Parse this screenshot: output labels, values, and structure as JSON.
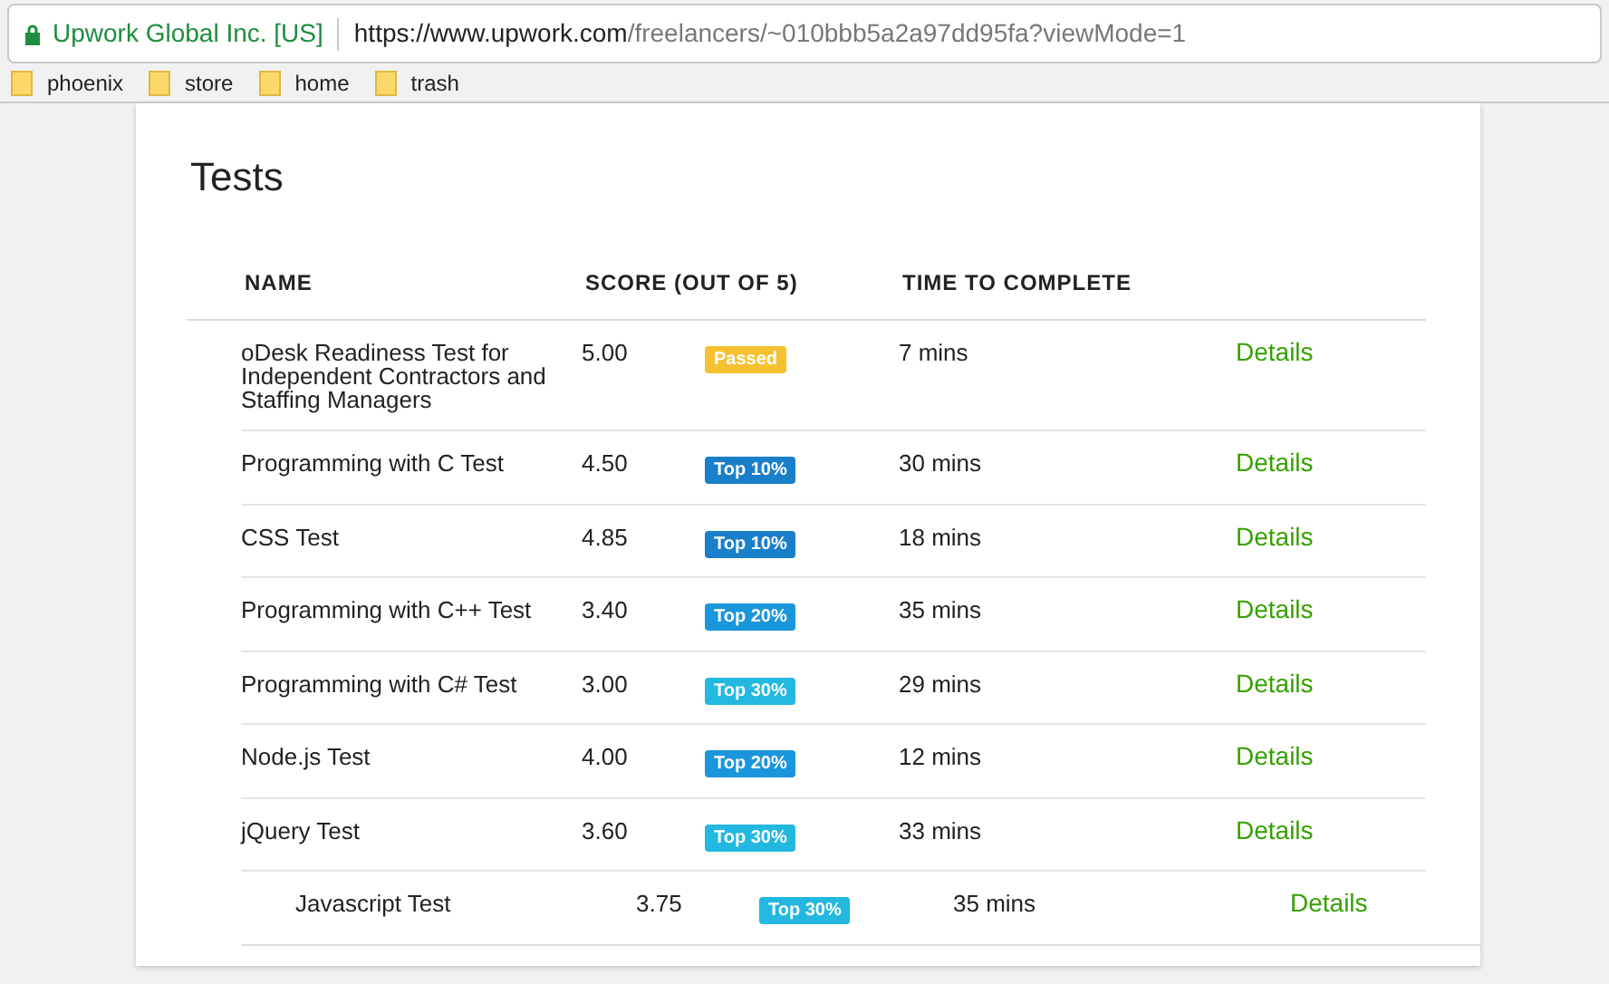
{
  "browser": {
    "site_identity": "Upwork Global Inc. [US]",
    "url_host": "https://www.upwork.com",
    "url_path": "/freelancers/~010bbb5a2a97dd95fa?viewMode=1"
  },
  "bookmarks": [
    "phoenix",
    "store",
    "home",
    "trash"
  ],
  "section": {
    "title": "Tests"
  },
  "table": {
    "columns": [
      "NAME",
      "SCORE (OUT OF 5)",
      "TIME TO COMPLETE"
    ],
    "rows": [
      {
        "name": "oDesk Readiness Test for Independent Contractors and Staffing Managers",
        "score": "5.00",
        "badge": {
          "text": "Passed",
          "color": "#f6c131"
        },
        "time": "7 mins",
        "link": "Details"
      },
      {
        "name": "Programming with C Test",
        "score": "4.50",
        "badge": {
          "text": "Top 10%",
          "color": "#1a7fc9"
        },
        "time": "30 mins",
        "link": "Details"
      },
      {
        "name": "CSS Test",
        "score": "4.85",
        "badge": {
          "text": "Top 10%",
          "color": "#1a7fc9"
        },
        "time": "18 mins",
        "link": "Details"
      },
      {
        "name": "Programming with C++ Test",
        "score": "3.40",
        "badge": {
          "text": "Top 20%",
          "color": "#1a96dc"
        },
        "time": "35 mins",
        "link": "Details"
      },
      {
        "name": "Programming with C# Test",
        "score": "3.00",
        "badge": {
          "text": "Top 30%",
          "color": "#22b8df"
        },
        "time": "29 mins",
        "link": "Details"
      },
      {
        "name": "Node.js Test",
        "score": "4.00",
        "badge": {
          "text": "Top 20%",
          "color": "#1a96dc"
        },
        "time": "12 mins",
        "link": "Details"
      },
      {
        "name": "jQuery Test",
        "score": "3.60",
        "badge": {
          "text": "Top 30%",
          "color": "#22b8df"
        },
        "time": "33 mins",
        "link": "Details"
      },
      {
        "name": "Javascript Test",
        "score": "3.75",
        "badge": {
          "text": "Top 30%",
          "color": "#22b8df"
        },
        "time": "35 mins",
        "link": "Details"
      }
    ]
  }
}
